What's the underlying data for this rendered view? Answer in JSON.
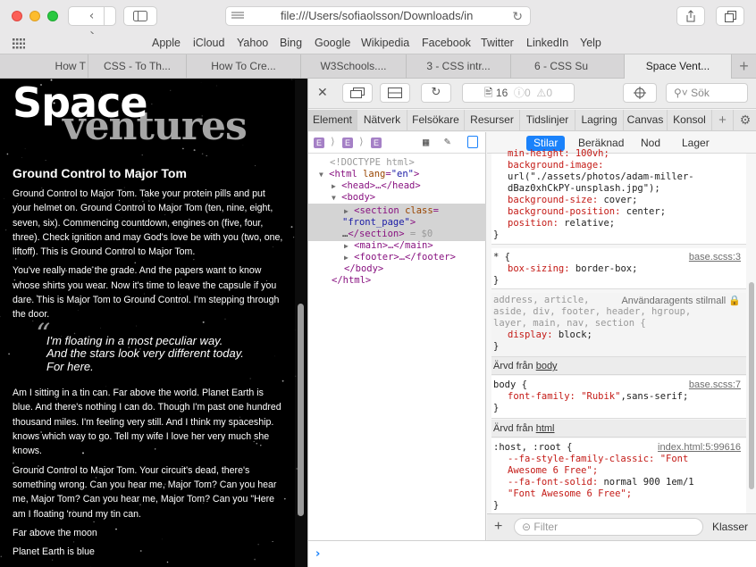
{
  "browser": {
    "url": "file:///Users/sofiaolsson/Downloads/in",
    "favorites": [
      "Apple",
      "iCloud",
      "Yahoo",
      "Bing",
      "Google",
      "Wikipedia",
      "Facebook",
      "Twitter",
      "LinkedIn",
      "Yelp"
    ],
    "tabs": [
      "How T",
      "CSS - To Th...",
      "How To Cre...",
      "W3Schools....",
      "3 - CSS intr...",
      "6 - CSS Su",
      "Space Vent..."
    ],
    "active_tab_index": 6
  },
  "page": {
    "title_main": "Space",
    "title_sub": "ventures",
    "heading": "Ground Control to Major Tom",
    "paragraphs": [
      "Ground Control to Major Tom. Take your protein pills and put your helmet on. Ground Control to Major Tom (ten, nine, eight, seven, six). Commencing countdown, engines on (five, four, three). Check ignition and may God's love be with you (two, one, liftoff). This is Ground Control to Major Tom.",
      "You've really made the grade. And the papers want to know whose shirts you wear. Now it's time to leave the capsule if you dare. This is Major Tom to Ground Control. I'm stepping through the door."
    ],
    "quote_mark": "“",
    "quote_lines": [
      "I'm floating in a most peculiar way.",
      "And the stars look very different today.",
      "For here."
    ],
    "paragraphs_after": [
      "Am I sitting in a tin can. Far above the world. Planet Earth is blue. And there's nothing I can do. Though I'm past one hundred thousand miles. I'm feeling very still. And I think my spaceship. knows which way to go. Tell my wife I love her very much she knows.",
      "Ground Control to Major Tom. Your circuit's dead, there's something wrong. Can you hear me, Major Tom? Can you hear me, Major Tom? Can you hear me, Major Tom? Can you \"Here am I floating 'round my tin can.",
      "Far above the moon",
      "Planet Earth is blue"
    ]
  },
  "inspector": {
    "resource_count": "16",
    "error_count": "0",
    "warning_count": "0",
    "search_placeholder": "Sök",
    "tabs": [
      "Element",
      "Nätverk",
      "Felsökare",
      "Resurser",
      "Tidslinjer",
      "Lagring",
      "Canvas",
      "Konsol"
    ],
    "breadcrumb_badge": "E",
    "dom_lines": {
      "doctype": "<!DOCTYPE html>",
      "html_open": "<html",
      "html_lang_attr": "lang",
      "html_lang_val": "\"en\"",
      "head": "<head>…</head>",
      "body_open": "<body>",
      "section_open": "<section",
      "section_class_attr": "class",
      "section_class_val": "\"front_page\"",
      "section_close_ell": "…",
      "section_close": "</section>",
      "section_dollar": "= $0",
      "main": "<main>…</main>",
      "footer": "<footer>…</footer>",
      "body_close": "</body>",
      "html_close": "</html>"
    },
    "style_tabs": [
      "Stilar",
      "Beräknad",
      "Nod",
      "Lager"
    ],
    "rules": {
      "r1_partial": "min-height: 100vh;",
      "r1_bg_img_prop": "background-image:",
      "r1_bg_img_val": "url(\"./assets/photos/adam-miller-",
      "r1_bg_img_val2": "dBaz0xhCkPY-unsplash.jpg\");",
      "r1_bg_size_prop": "background-size:",
      "r1_bg_size_val": "cover;",
      "r1_bg_pos_prop": "background-position:",
      "r1_bg_pos_val": "center;",
      "r1_pos_prop": "position:",
      "r1_pos_val": "relative;",
      "r2_selector": "* {",
      "r2_source": "base.scss:3",
      "r2_prop": "box-sizing:",
      "r2_val": "border-box;",
      "r3_selector_1": "address, article,",
      "r3_source": "Användaragents stilmall",
      "r3_selector_2": "aside, div, footer, header, hgroup,",
      "r3_selector_3": "layer, main, nav, section {",
      "r3_prop": "display:",
      "r3_val": "block;",
      "inh1_label": "Ärvd från",
      "inh1_link": "body",
      "r4_selector": "body {",
      "r4_source": "base.scss:7",
      "r4_prop": "font-family:",
      "r4_val_str": "\"Rubik\"",
      "r4_val_rest": ",sans-serif;",
      "inh2_label": "Ärvd från",
      "inh2_link": "html",
      "r5_selector": ":host, :root {",
      "r5_source": "index.html:5:99616",
      "r5_p1": "--fa-style-family-classic:",
      "r5_v1": "\"Font",
      "r5_v1b": "Awesome 6 Free\";",
      "r5_p2": "--fa-font-solid:",
      "r5_v2": "normal 900 1em/1",
      "r5_v2b": "\"Font Awesome 6 Free\";"
    },
    "filter_placeholder": "Filter",
    "classes_label": "Klasser"
  },
  "colors": {
    "accent": "#1a82fb",
    "tag": "#881280",
    "attribute": "#994500",
    "attr_value": "#1a1aa6",
    "property": "#c41a16"
  }
}
